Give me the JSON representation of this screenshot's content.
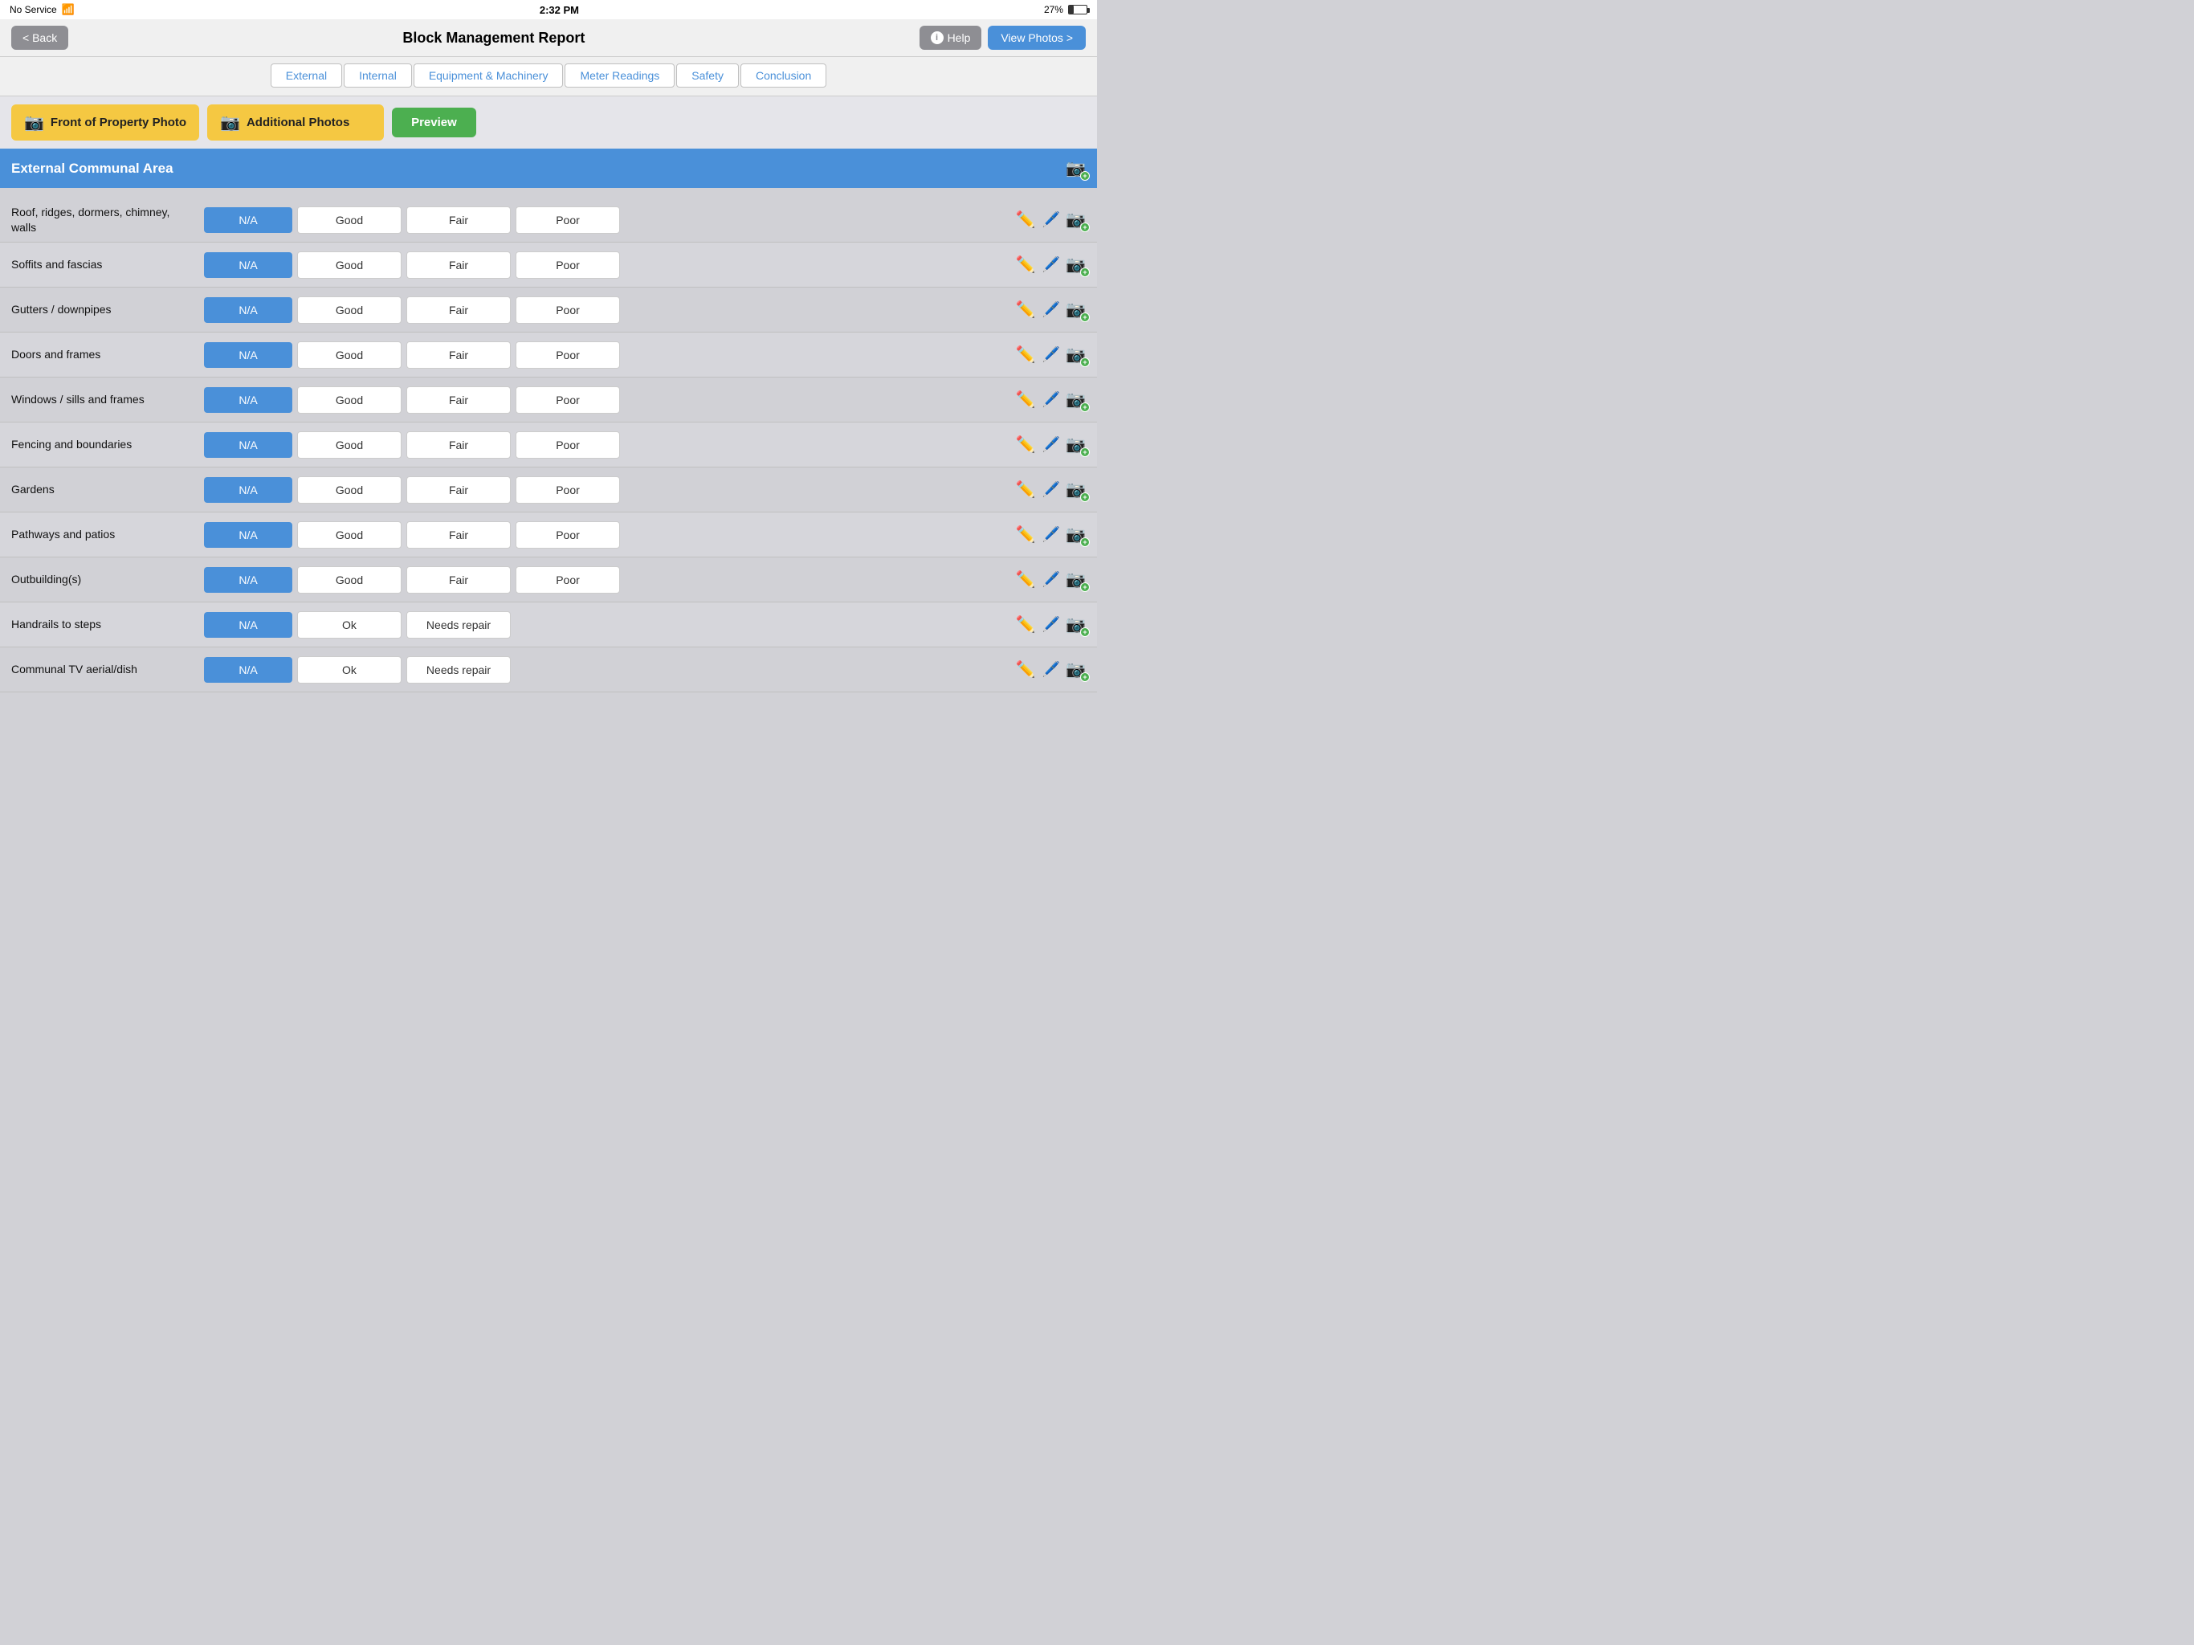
{
  "statusBar": {
    "noService": "No Service",
    "time": "2:32 PM",
    "battery": "27%"
  },
  "navBar": {
    "backLabel": "< Back",
    "title": "Block Management Report",
    "helpLabel": "Help",
    "viewPhotosLabel": "View Photos >"
  },
  "tabs": [
    {
      "id": "external",
      "label": "External"
    },
    {
      "id": "internal",
      "label": "Internal"
    },
    {
      "id": "equipment",
      "label": "Equipment & Machinery"
    },
    {
      "id": "meter",
      "label": "Meter Readings"
    },
    {
      "id": "safety",
      "label": "Safety"
    },
    {
      "id": "conclusion",
      "label": "Conclusion"
    }
  ],
  "photoBar": {
    "frontPhotoLabel": "Front of Property Photo",
    "additionalPhotosLabel": "Additional Photos",
    "previewLabel": "Preview"
  },
  "sectionHeader": {
    "title": "External Communal Area"
  },
  "rows": [
    {
      "label": "Roof, ridges, dormers, chimney, walls",
      "naLabel": "N/A",
      "options": [
        "Good",
        "Fair",
        "Poor"
      ]
    },
    {
      "label": "Soffits and fascias",
      "naLabel": "N/A",
      "options": [
        "Good",
        "Fair",
        "Poor"
      ]
    },
    {
      "label": "Gutters / downpipes",
      "naLabel": "N/A",
      "options": [
        "Good",
        "Fair",
        "Poor"
      ]
    },
    {
      "label": "Doors and frames",
      "naLabel": "N/A",
      "options": [
        "Good",
        "Fair",
        "Poor"
      ]
    },
    {
      "label": "Windows / sills and frames",
      "naLabel": "N/A",
      "options": [
        "Good",
        "Fair",
        "Poor"
      ]
    },
    {
      "label": "Fencing and boundaries",
      "naLabel": "N/A",
      "options": [
        "Good",
        "Fair",
        "Poor"
      ]
    },
    {
      "label": "Gardens",
      "naLabel": "N/A",
      "options": [
        "Good",
        "Fair",
        "Poor"
      ]
    },
    {
      "label": "Pathways and patios",
      "naLabel": "N/A",
      "options": [
        "Good",
        "Fair",
        "Poor"
      ]
    },
    {
      "label": "Outbuilding(s)",
      "naLabel": "N/A",
      "options": [
        "Good",
        "Fair",
        "Poor"
      ]
    },
    {
      "label": "Handrails to steps",
      "naLabel": "N/A",
      "options": [
        "Ok",
        "Needs repair"
      ]
    },
    {
      "label": "Communal TV aerial/dish",
      "naLabel": "N/A",
      "options": [
        "Ok",
        "Needs repair"
      ]
    }
  ]
}
